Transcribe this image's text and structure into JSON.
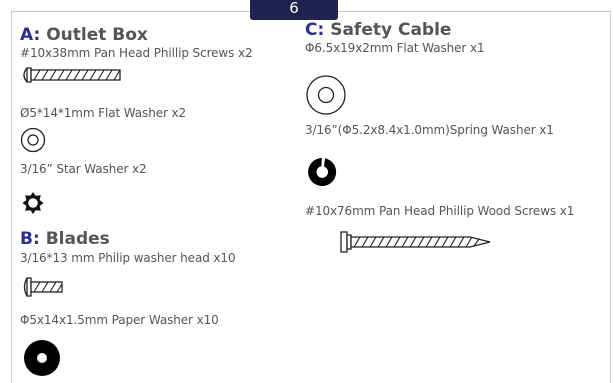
{
  "step_tab": "6",
  "section_a": {
    "letter": "A:",
    "title": "Outlet Box",
    "items": [
      "#10x38mm Pan Head Phillip Screws x2",
      "Ø5*14*1mm Flat Washer x2",
      "3/16” Star Washer x2"
    ]
  },
  "section_b": {
    "letter": "B:",
    "title": "Blades",
    "items": [
      "3/16*13 mm Philip washer head x10",
      "Φ5x14x1.5mm Paper Washer x10"
    ]
  },
  "section_c": {
    "letter": "C:",
    "title": "Safety Cable",
    "items": [
      "Φ6.5x19x2mm Flat Washer x1",
      "3/16”(Φ5.2x8.4x1.0mm)Spring Washer x1",
      "#10x76mm Pan Head Phillip Wood Screws x1"
    ]
  },
  "colors": {
    "accent": "#2a2f8f",
    "tab": "#20234f",
    "text": "#555555",
    "border": "#c8c8c8"
  },
  "icons": [
    "pan-head-screw-icon",
    "flat-washer-icon",
    "star-washer-icon",
    "washer-head-screw-icon",
    "paper-washer-icon",
    "spring-washer-icon",
    "wood-screw-icon"
  ]
}
